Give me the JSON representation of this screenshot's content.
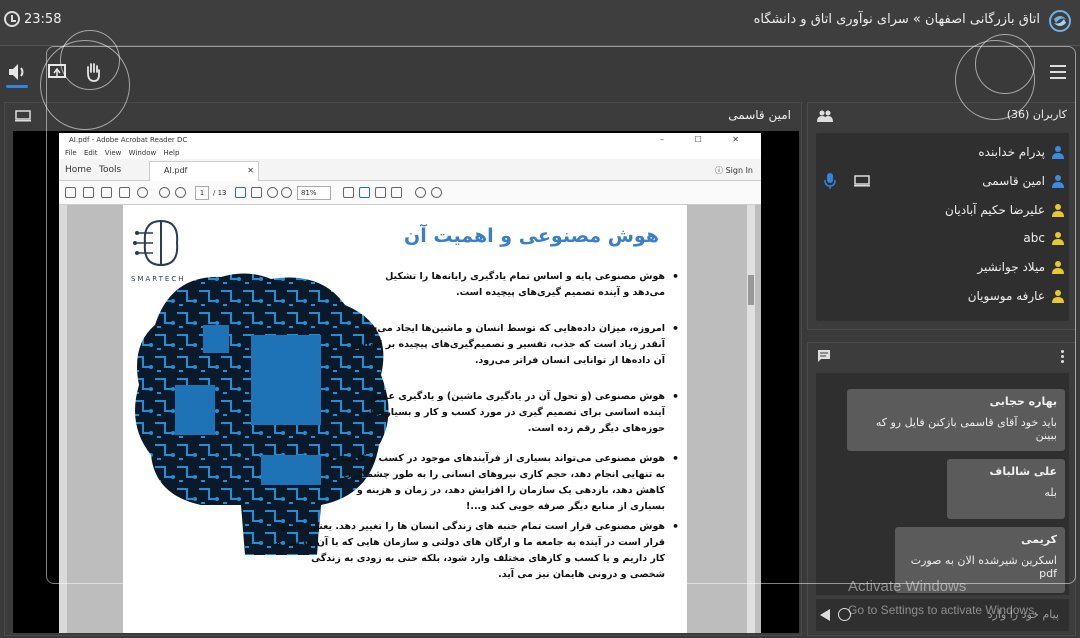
{
  "header": {
    "time": "23:58",
    "breadcrumb": "اتاق بازرگانی اصفهان » سرای نوآوری اتاق و دانشگاه"
  },
  "presenter": {
    "name": "امین قاسمی"
  },
  "acrobat": {
    "window_title": "AI.pdf - Adobe Acrobat Reader DC",
    "menu": [
      "File",
      "Edit",
      "View",
      "Window",
      "Help"
    ],
    "tab_home": "Home",
    "tab_tools": "Tools",
    "file_tab": "AI.pdf",
    "sign_in": "Sign In",
    "page_current": "1",
    "page_total": "/ 13",
    "zoom": "81%"
  },
  "slide": {
    "brand": "SMARTECH",
    "title": "هوش مصنوعی و اهمیت آن",
    "bullets": [
      "هوش مصنوعی پایه و اساس تمام یادگیری رایانه‌ها را تشکیل می‌دهد و آینده تصمیم گیری‌های پیچیده است.",
      "امروزه، میزان داده‌هایی که توسط انسان و ماشین‌ها ایجاد می‌شود آنقدر زیاد است که جذب، تفسیر و تصمیم‌گیری‌های پیچیده بر اساس آن داده‌ها از توانایی انسان فراتر می‌رود.",
      "هوش مصنوعی (و تحول آن در یادگیری ماشین) و یادگیری عمیق آینده اساسی برای تصمیم گیری در مورد کسب و کار و بسیاری از حوزه‌های دیگر رقم زده است.",
      "هوش مصنوعی می‌تواند بسیاری از فرآیندهای موجود در کسب و کارها را به تنهایی انجام دهد، حجم کاری نیروهای انسانی را به طور چشمگیری کاهش دهد، بازدهی یک سازمان را افزایش دهد، در زمان و هزینه و بسیاری از منابع دیگر صرفه جویی کند و...!",
      "هوش مصنوعی قرار است تمام جنبه های زندگی انسان ها را تغییر دهد. یعنی نه تنها قرار است در آینده به جامعه ما و ارگان های دولتی و سازمان هایی که با آن ها سر و کار داریم و یا کسب و کارهای مختلف وارد شود، بلکه حتی به زودی به زندگی شخصی و درونی هایمان نیز می آید."
    ]
  },
  "users": {
    "title": "کاربران (36)",
    "list": [
      {
        "name": "پدرام خدابنده",
        "color": "#3d8be0"
      },
      {
        "name": "امین قاسمی",
        "color": "#3d8be0"
      },
      {
        "name": "علیرضا حکیم آبادیان",
        "color": "#e6c830"
      },
      {
        "name": "abc",
        "color": "#e6c830"
      },
      {
        "name": "میلاد جوانشیر",
        "color": "#e6c830"
      },
      {
        "name": "عارفه موسویان",
        "color": "#e6c830"
      }
    ]
  },
  "chat": {
    "messages": [
      {
        "sender": "بهاره حجابی",
        "text": "باید خود آقای قاسمی بازکنن فایل رو که ببینن"
      },
      {
        "sender": "علی شالباف",
        "text": "بله"
      },
      {
        "sender": "کریمی",
        "text": "اسکرین شیرشده الان به صورت pdf"
      }
    ],
    "placeholder": "پیام خود را وارد"
  },
  "watermark": {
    "title": "Activate Windows",
    "subtitle": "Go to Settings to activate Windows."
  },
  "colors": {
    "accent": "#2f86e0",
    "slide_title": "#3a80c8",
    "presenter_icon": "#3d8be0",
    "viewer_icon": "#e6c830"
  }
}
